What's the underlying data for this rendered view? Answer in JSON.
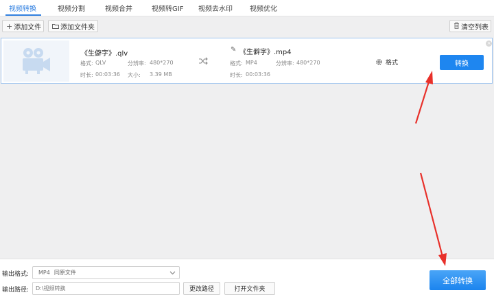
{
  "tabs": [
    {
      "label": "视频转换"
    },
    {
      "label": "视频分割"
    },
    {
      "label": "视频合并"
    },
    {
      "label": "视频转GIF"
    },
    {
      "label": "视频去水印"
    },
    {
      "label": "视频优化"
    }
  ],
  "toolbar": {
    "add_file": "添加文件",
    "add_folder": "添加文件夹",
    "clear_list": "清空列表"
  },
  "file": {
    "source": {
      "name": "《生僻字》.qlv",
      "format_label": "格式:",
      "format": "QLV",
      "resolution_label": "分辨率:",
      "resolution": "480*270",
      "duration_label": "时长:",
      "duration": "00:03:36",
      "size_label": "大小:",
      "size": "3.39 MB"
    },
    "target": {
      "name": "《生僻字》.mp4",
      "format_label": "格式:",
      "format": "MP4",
      "resolution_label": "分辨率:",
      "resolution": "480*270",
      "duration_label": "时长:",
      "duration": "00:03:36"
    },
    "format_button": "格式",
    "convert_button": "转换"
  },
  "bottom": {
    "output_format_label": "输出格式:",
    "output_format_value": "MP4",
    "output_format_sub": "同原文件",
    "output_path_label": "输出路径:",
    "output_path_value": "D:\\视频转换",
    "change_path": "更改路径",
    "open_folder": "打开文件夹",
    "convert_all": "全部转换"
  },
  "colors": {
    "accent": "#1e86f0",
    "annotation_arrow": "#e8302a"
  }
}
